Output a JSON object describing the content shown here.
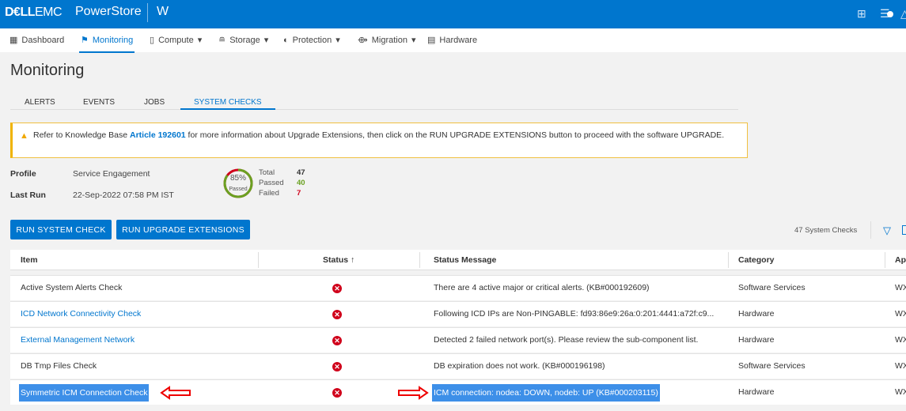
{
  "header": {
    "brand_dell": "D€LL",
    "brand_emc": "EMC",
    "product": "PowerStore",
    "system": "W"
  },
  "nav": [
    {
      "label": "Dashboard"
    },
    {
      "label": "Monitoring"
    },
    {
      "label": "Compute"
    },
    {
      "label": "Storage"
    },
    {
      "label": "Protection"
    },
    {
      "label": "Migration"
    },
    {
      "label": "Hardware"
    }
  ],
  "page_title": "Monitoring",
  "tabs": [
    "ALERTS",
    "EVENTS",
    "JOBS",
    "SYSTEM CHECKS"
  ],
  "banner": {
    "pre": "Refer to Knowledge Base ",
    "link": "Article 192601",
    "post": " for more information about Upgrade Extensions, then click on the RUN UPGRADE EXTENSIONS button to proceed with the software UPGRADE."
  },
  "summary": {
    "profile_label": "Profile",
    "profile": "Service Engagement",
    "lastrun_label": "Last Run",
    "lastrun": "22-Sep-2022 07:58 PM IST",
    "percent": "85%",
    "percent_value": 85,
    "percent_label": "Passed",
    "total_label": "Total",
    "total": "47",
    "passed_label": "Passed",
    "passed": "40",
    "failed_label": "Failed",
    "failed": "7"
  },
  "buttons": {
    "run_check": "RUN SYSTEM CHECK",
    "run_upgrade": "RUN UPGRADE EXTENSIONS"
  },
  "count": "47 System Checks",
  "columns": [
    "Item",
    "Status",
    "Status Message",
    "Category",
    "Ap"
  ],
  "sort_icon": "↑",
  "rows": [
    {
      "item": "Active System Alerts Check",
      "link": false,
      "message": "There are 4 active major or critical alerts. (KB#000192609)",
      "category": "Software Services",
      "appliance": "WX"
    },
    {
      "item": "ICD Network Connectivity Check",
      "link": true,
      "message": "Following ICD IPs are Non-PINGABLE: fd93:86e9:26a:0:201:4441:a72f:c9...",
      "category": "Hardware",
      "appliance": "WX"
    },
    {
      "item": "External Management Network",
      "link": true,
      "message": "Detected 2 failed network port(s). Please review the sub-component list.",
      "category": "Hardware",
      "appliance": "WX"
    },
    {
      "item": "DB Tmp Files Check",
      "link": false,
      "message": "DB expiration does not work. (KB#000196198)",
      "category": "Software Services",
      "appliance": "WX"
    },
    {
      "item": "Symmetric ICM Connection Check",
      "link": false,
      "message": "ICM connection: nodea: DOWN, nodeb: UP (KB#000203115)",
      "category": "Hardware",
      "appliance": "WX"
    }
  ],
  "colors": {
    "brand": "#0076ce",
    "failed": "#d0021b",
    "passed": "#6aa121"
  }
}
